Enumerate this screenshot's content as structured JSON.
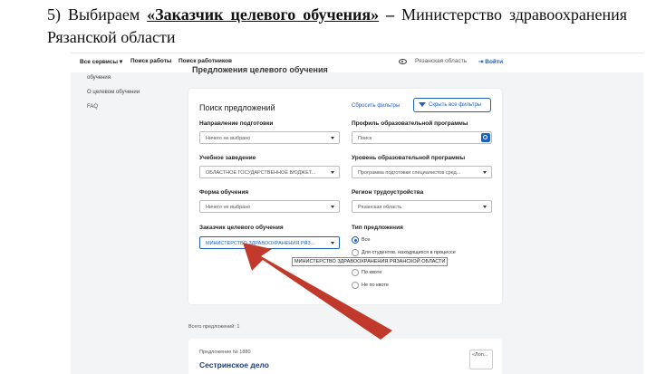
{
  "instruction": {
    "number": "5) Выбираем",
    "bold_part": "«Заказчик целевого обучения»",
    "dash": "–",
    "rest": "Министерство здравоохранения Рязанской области"
  },
  "topbar": {
    "all_services": "Все сервисы ▾",
    "job_search": "Поиск работы",
    "worker_search": "Поиск работников",
    "region": "Рязанская область",
    "login": "Войти"
  },
  "sidebar": {
    "items": [
      "обучения",
      "О целевом обучении",
      "FAQ"
    ]
  },
  "page_heading": "Предложения целевого обучения",
  "search_card": {
    "title": "Поиск предложений",
    "reset_filters": "Сбросить фильтры",
    "hide_filters": "Скрыть все фильтры",
    "fields": {
      "direction": {
        "label": "Направление подготовки",
        "value": "Ничего не выбрано"
      },
      "profile": {
        "label": "Профиль образовательной программы",
        "placeholder": "Поиск"
      },
      "institution": {
        "label": "Учебное заведение",
        "value": "ОБЛАСТНОЕ ГОСУДАРСТВЕННОЕ БЮДЖЕТ..."
      },
      "level": {
        "label": "Уровень образовательной программы",
        "value": "Программа подготовки специалистов сред..."
      },
      "form": {
        "label": "Форма обучения",
        "value": "Ничего не выбрано"
      },
      "region": {
        "label": "Регион трудоустройства",
        "value": "Рязанская область"
      },
      "customer": {
        "label": "Заказчик целевого обучения",
        "value": "МИНИСТЕРСТВО ЗДРАВООХРАНЕНИЯ РЯЗ..."
      }
    },
    "offer_type": {
      "label": "Тип предложения",
      "options": [
        {
          "label": "Все",
          "checked": true
        },
        {
          "label": "Для студентов, находящихся в процессе",
          "checked": false
        },
        {
          "label": "По квоте",
          "checked": false
        },
        {
          "label": "Не по квоте",
          "checked": false
        }
      ]
    },
    "tooltip": "МИНИСТЕРСТВО ЗДРАВООХРАНЕНИЯ РЯЗАНСКОЙ ОБЛАСТИ"
  },
  "results": {
    "total": "Всего предложений: 1",
    "offer_number": "Предложение № 1880",
    "offer_title": "Сестринское дело",
    "offer_tag": "«Лоп..."
  },
  "colors": {
    "accent": "#1f5fbf",
    "arrow": "#c0392b"
  }
}
